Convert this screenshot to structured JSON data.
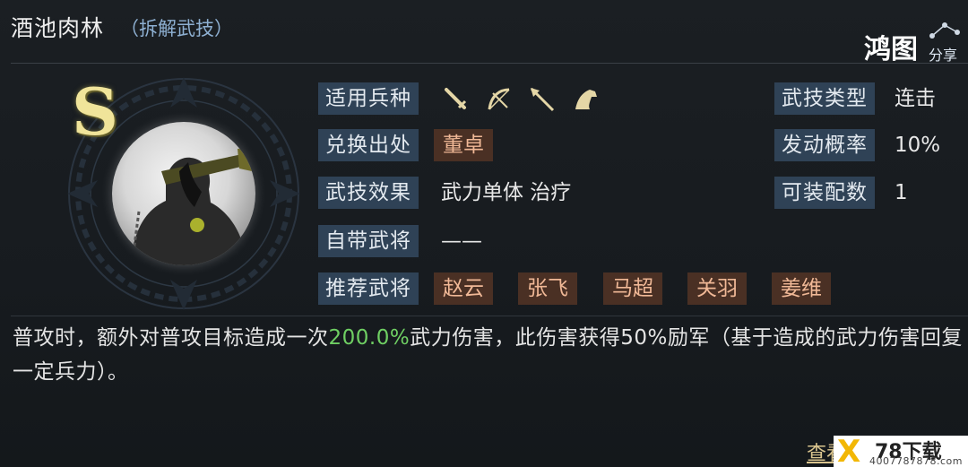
{
  "header": {
    "title": "酒池肉林",
    "subtitle": "（拆解武技）"
  },
  "skill": {
    "grade": "S"
  },
  "rows": {
    "troop_label": "适用兵种",
    "troop_icons": [
      "sword-icon",
      "bow-icon",
      "spear-icon",
      "horse-icon"
    ],
    "source_label": "兑换出处",
    "source_value": "董卓",
    "effect_label": "武技效果",
    "effect_value": "武力单体 治疗",
    "own_label": "自带武将",
    "own_value": "——",
    "recommend_label": "推荐武将",
    "recommend_values": [
      "赵云",
      "张飞",
      "马超",
      "关羽",
      "姜维"
    ],
    "type_label": "武技类型",
    "type_value": "连击",
    "chance_label": "发动概率",
    "chance_value": "10%",
    "slots_label": "可装配数",
    "slots_value": "1"
  },
  "description": {
    "part1": "普攻时，额外对普攻目标造成一次",
    "highlight": "200.0%",
    "part2": "武力伤害，此伤害获得50%励军（基于造成的武力伤害回复一定兵力）。"
  },
  "footer": {
    "view_link": "查看"
  },
  "watermarks": {
    "top_logo": "鸿图",
    "top_sub": "分享",
    "badge_name": "78下载",
    "badge_url": "4007787878.com"
  },
  "colors": {
    "label_bg": "#2f4256",
    "tag_bg": "#4a3024",
    "tag_text": "#f0b896",
    "highlight": "#6fcf63",
    "grade": "#f0e49a"
  }
}
